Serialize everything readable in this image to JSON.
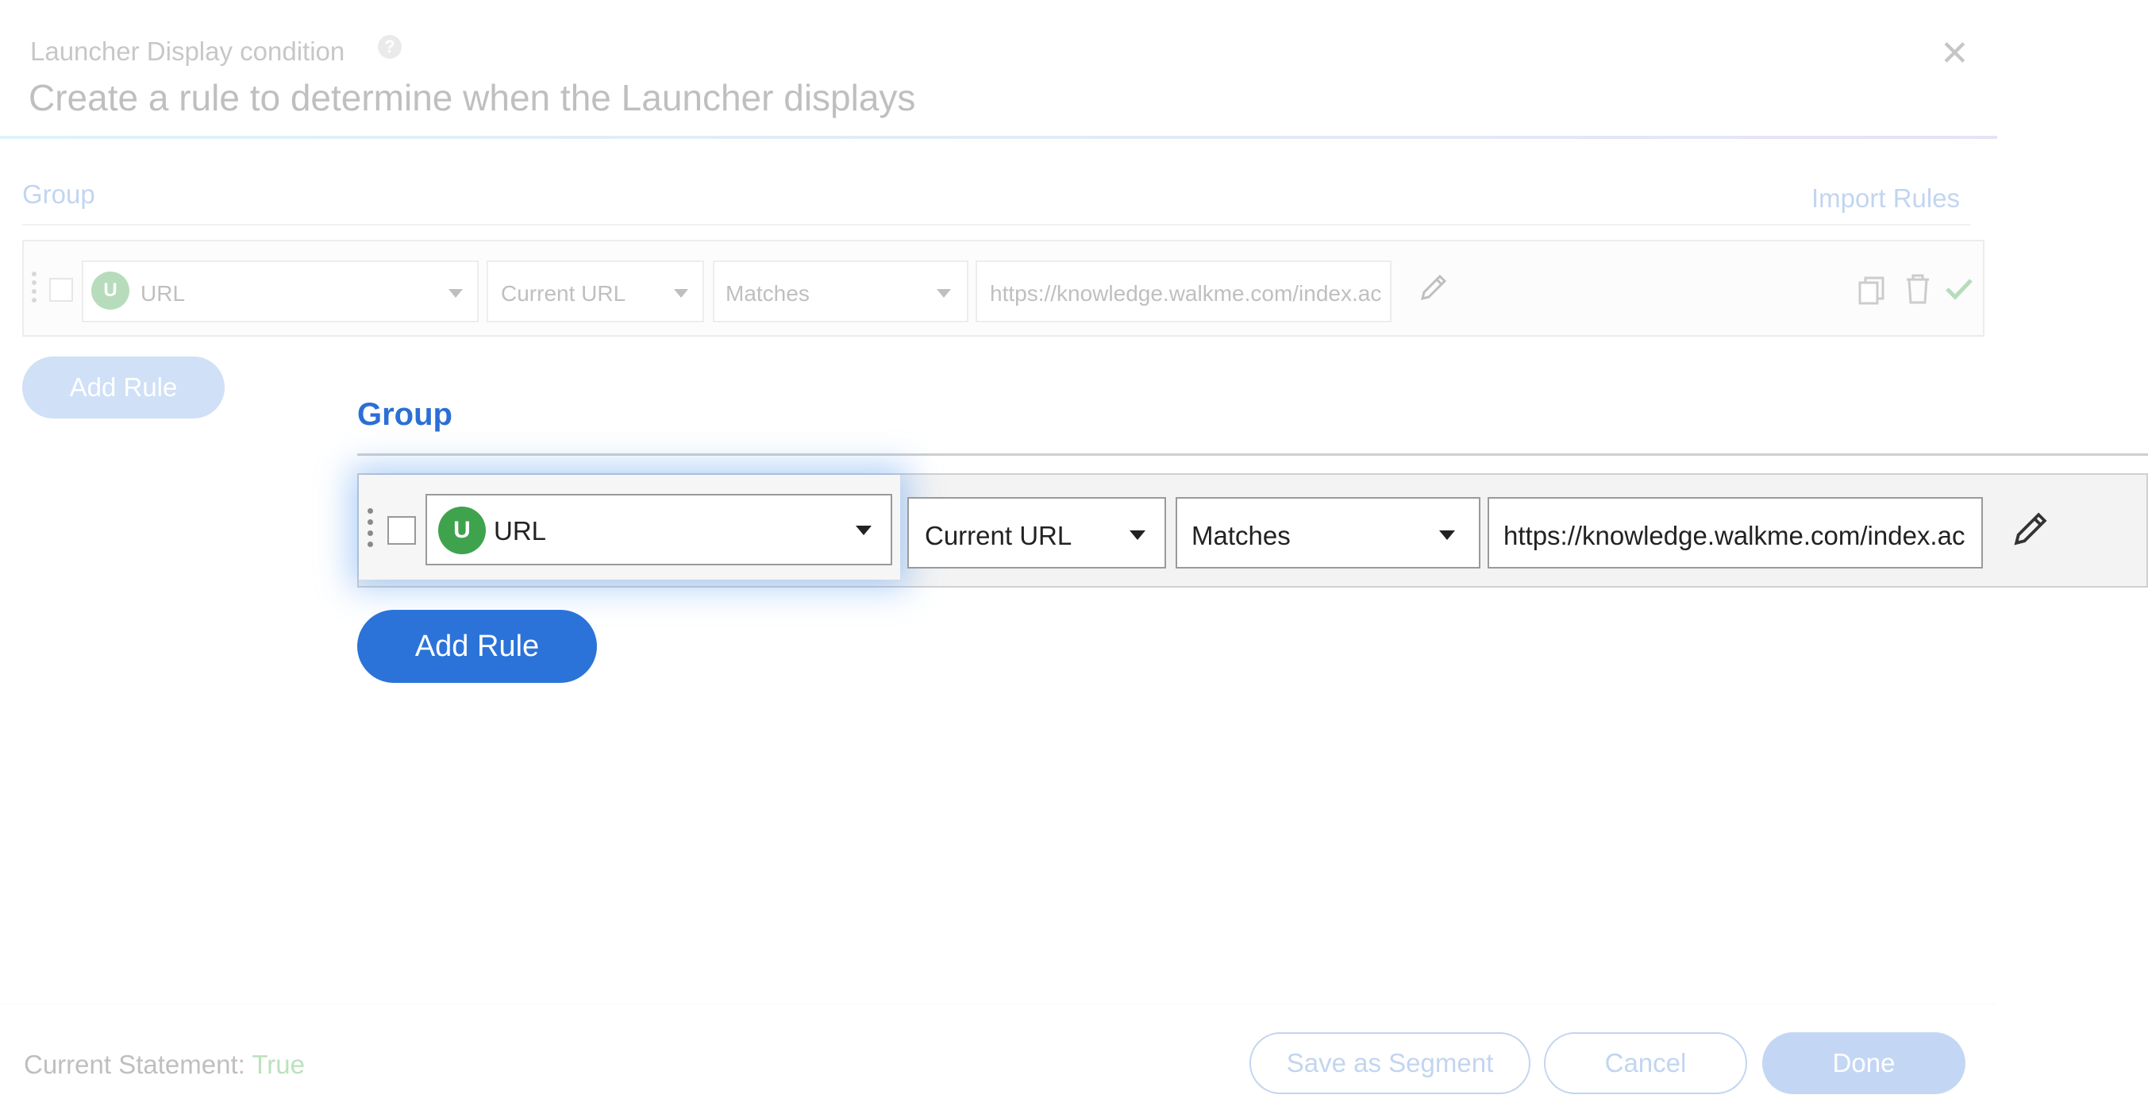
{
  "dialog": {
    "label": "Launcher Display condition",
    "title": "Create a rule to determine when the Launcher displays",
    "help_glyph": "?",
    "close_glyph": "✕"
  },
  "background_group": {
    "title": "Group",
    "import_label": "Import Rules",
    "rule": {
      "badge": "U",
      "type_value": "URL",
      "attribute_value": "Current URL",
      "operator_value": "Matches",
      "url_value": "https://knowledge.walkme.com/index.ac"
    },
    "add_rule_label": "Add Rule"
  },
  "dragged_group": {
    "title": "Group",
    "rule": {
      "badge": "U",
      "type_value": "URL",
      "attribute_value": "Current URL",
      "operator_value": "Matches",
      "url_value": "https://knowledge.walkme.com/index.ac"
    },
    "add_rule_label": "Add Rule"
  },
  "footer": {
    "statement_label": "Current Statement:",
    "statement_value": "True",
    "save_segment_label": "Save as Segment",
    "cancel_label": "Cancel",
    "done_label": "Done"
  },
  "colors": {
    "accent": "#2b73d9",
    "badge_green": "#3fa34d",
    "true_green": "#4caf50"
  }
}
